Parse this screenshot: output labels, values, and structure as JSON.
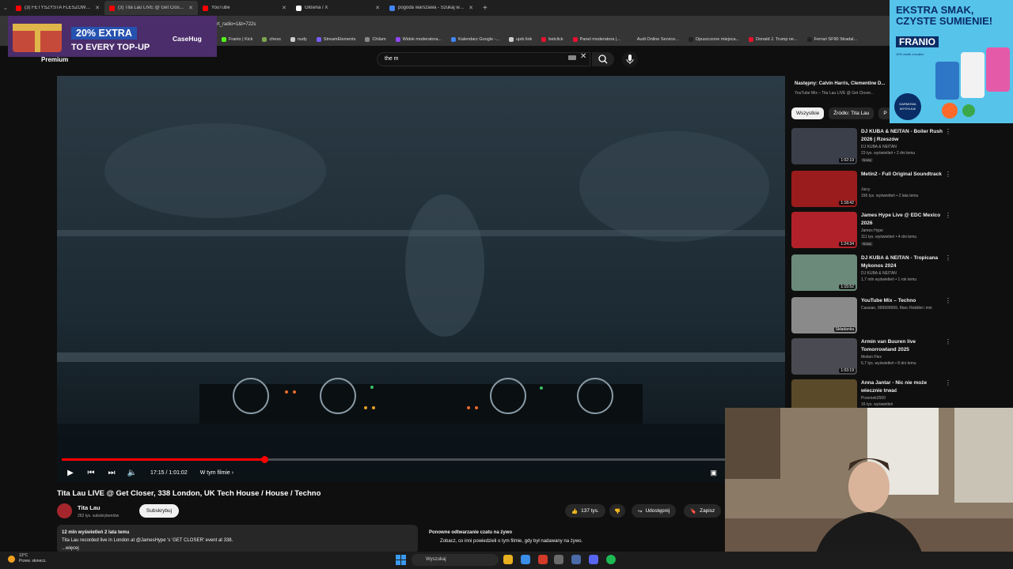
{
  "tabs": [
    {
      "title": "(3) FETYSZYSTA FLESZOWY | C...",
      "color": "#ff0000",
      "active": false
    },
    {
      "title": "(3) Tita Lau LIVE @ Get Closer...",
      "color": "#ff0000",
      "active": true
    },
    {
      "title": "YouTube",
      "color": "#ff0000",
      "active": false
    },
    {
      "title": "Główna / X",
      "color": "#ffffff",
      "active": false
    },
    {
      "title": "pogoda warszawa - Szukaj w G...",
      "color": "#4285f4",
      "active": false
    }
  ],
  "address": {
    "url_fragment": "rt_radio=1&t=722s"
  },
  "bookmarks": [
    {
      "label": "Franio | Kick",
      "color": "#53fc18"
    },
    {
      "label": "chess",
      "color": "#7fa650"
    },
    {
      "label": "nudy",
      "color": "#cccccc"
    },
    {
      "label": "StreamElements",
      "color": "#7b5cff"
    },
    {
      "label": "Chilam",
      "color": "#888888"
    },
    {
      "label": "Widok moderatora...",
      "color": "#9146ff"
    },
    {
      "label": "Kalendarz Google -...",
      "color": "#4285f4"
    },
    {
      "label": "ujeb link",
      "color": "#cccccc"
    },
    {
      "label": "betclick",
      "color": "#e8112d"
    },
    {
      "label": "Panel moderatora |...",
      "color": "#e8112d"
    },
    {
      "label": "Audi Online Service...",
      "color": "#333333"
    },
    {
      "label": "Opuszczone miejsca...",
      "color": "#222222"
    },
    {
      "label": "Donald J. Trump ne...",
      "color": "#e8112d"
    },
    {
      "label": "Ferrari SF90 Stradal...",
      "color": "#222222"
    }
  ],
  "masthead": {
    "premium_label": "Premium",
    "search_value": "the m"
  },
  "player": {
    "time": "17:15 / 1:01:02",
    "chapter": "W tym filmie",
    "progress_fraction": 0.281,
    "title": "Tita Lau LIVE @ Get Closer, 338 London, UK Tech House / House / Techno",
    "channel": "Tita Lau",
    "subscribers": "262 tys. subskrybentów",
    "subscribe_label": "Subskrybuj",
    "likes": "137 tys.",
    "share_label": "Udostępnij",
    "save_label": "Zapisz"
  },
  "description": {
    "meta": "12 mln wyświetleń  2 lata temu",
    "text": "Tita Lau recorded live in London at  @JamesHype  's 'GET CLOSER' event at 338.",
    "more": "...więcej"
  },
  "replay": {
    "title": "Ponowne odtwarzanie czatu na żywo",
    "text": "Zobacz, co inni powiedzieli o tym filmie, gdy był nadawany na żywo."
  },
  "up_next": {
    "line1": "Następny: Calvin Harris, Clementine D...",
    "line2": "YouTube Mix – Tita Lau LIVE @ Get Closer..."
  },
  "chips": [
    "Wszystkie",
    "Źródło: Tita Lau",
    "P"
  ],
  "recommendations": [
    {
      "title": "DJ KUBA & NEITAN - Boiler Rush 2026 | Rzeszów",
      "channel": "DJ KUBA & NEITAN",
      "meta": "23 tys. wyświetleń • 2 dni temu",
      "badge": "Nowy",
      "duration": "1:02:19",
      "color": "#3a3f4a"
    },
    {
      "title": "Metin2 - Full Original Soundtrack",
      "channel": "Juicy",
      "meta": "156 tys. wyświetleń • 2 lata temu",
      "badge": "",
      "duration": "1:18:42",
      "color": "#9a1c1c"
    },
    {
      "title": "James Hype Live @ EDC Mexico 2026",
      "channel": "James Hype",
      "meta": "111 tys. wyświetleń • 4 dni temu",
      "badge": "Nowy",
      "duration": "1:24:34",
      "color": "#b0212a"
    },
    {
      "title": "DJ KUBA & NEITAN - Tropicana Mykonos 2024",
      "channel": "DJ KUBA & NEITAN",
      "meta": "1,7 mln wyświetleń • 1 rok temu",
      "badge": "",
      "duration": "1:15:52",
      "color": "#6b8a7a"
    },
    {
      "title": "YouTube Mix – Techno",
      "channel": "Cassian, 999999999, Marc Rebillet i inni",
      "meta": "",
      "badge": "",
      "duration": "Składanka",
      "color": "#8a8a8a"
    },
    {
      "title": "Armin van Buuren live Tomorrowland 2025",
      "channel": "Motion Flex",
      "meta": "6,7 tys. wyświetleń • 8 dni temu",
      "badge": "",
      "duration": "1:03:19",
      "color": "#4a4a52"
    },
    {
      "title": "Anna Jantar - Nic nie może wiecznie trwać",
      "channel": "Przemek2500",
      "meta": "16 tys. wyświetleń",
      "badge": "",
      "duration": "",
      "color": "#5a4a2a"
    }
  ],
  "ad_banner": {
    "main": "20% EXTRA",
    "sub": "TO EVERY TOP-UP",
    "brand": "CaseHug"
  },
  "franio_ad": {
    "headline": "EKSTRA SMAK, CZYSTE SUMIENIE!",
    "brand": "FRANIO",
    "small": "10% zniżki z kodem",
    "free": "DARMOWA WYSYŁKA!"
  },
  "taskbar": {
    "temp": "13°C",
    "weather": "Przew. słonecz.",
    "search": "Wyszukaj"
  }
}
